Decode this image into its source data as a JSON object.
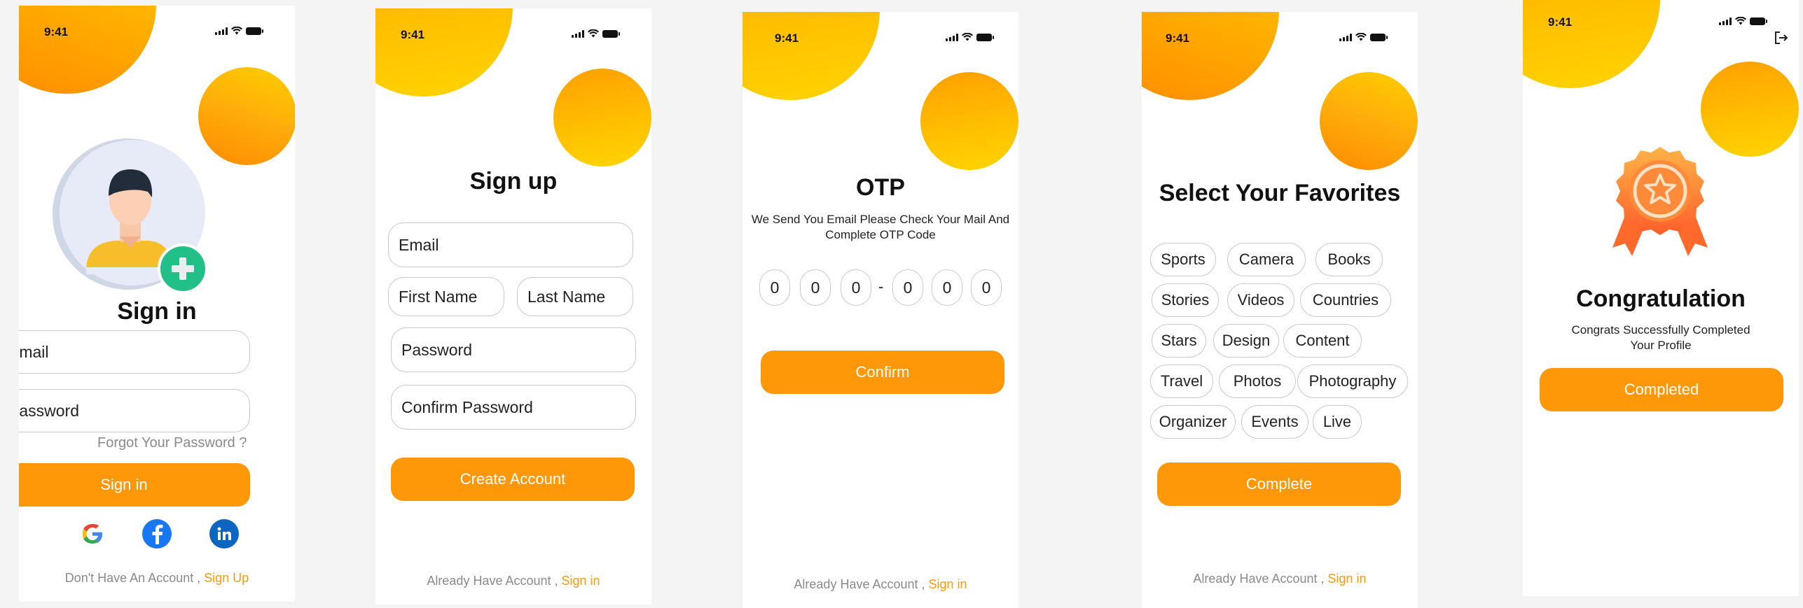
{
  "status": {
    "time": "9:41"
  },
  "signin": {
    "title": "Sign in",
    "email_placeholder": "Email",
    "password_placeholder": "Password",
    "forgot": "Forgot Your Password ?",
    "button": "Sign in",
    "footer_text": "Don't Have An Account ,",
    "footer_link": "Sign Up",
    "socials": [
      "google-icon",
      "facebook-icon",
      "linkedin-icon"
    ]
  },
  "signup": {
    "title": "Sign up",
    "email": "Email",
    "first_name": "First Name",
    "last_name": "Last Name",
    "password": "Password",
    "confirm_password": "Confirm Password",
    "button": "Create Account",
    "footer_text": "Already Have Account ,",
    "footer_link": "Sign in"
  },
  "otp": {
    "title": "OTP",
    "subtitle_line1": "We Send You Email Please Check  Your Mail  And",
    "subtitle_line2": "Complete OTP Code",
    "digits": [
      "0",
      "0",
      "0",
      "0",
      "0",
      "0"
    ],
    "separator": "-",
    "button": "Confirm",
    "footer_text": "Already Have  Account ,",
    "footer_link": "Sign in"
  },
  "favorites": {
    "title": "Select Your Favorites",
    "chips": [
      "Sports",
      "Camera",
      "Books",
      "Stories",
      "Videos",
      "Countries",
      "Stars",
      "Design",
      "Content",
      "Travel",
      "Photos",
      "Photography",
      "Organizer",
      "Events",
      "Live"
    ],
    "button": "Complete",
    "footer_text": "Already Have  Account ,",
    "footer_link": "Sign in"
  },
  "congrats": {
    "title": "Congratulation",
    "subtitle_line1": "Congrats Successfully Completed",
    "subtitle_line2": "Your Profile",
    "button": "Completed"
  },
  "colors": {
    "accent": "#ff9808",
    "link": "#ff9808",
    "border": "#c9c9c9"
  }
}
